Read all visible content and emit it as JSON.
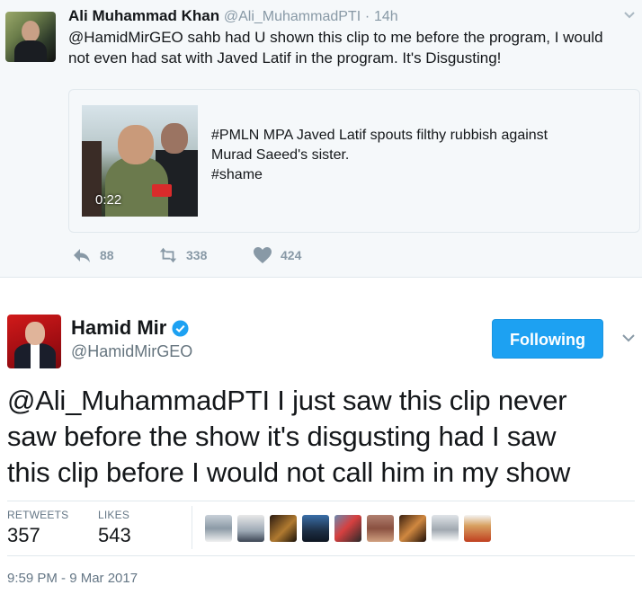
{
  "quoted_tweet": {
    "author_name": "Ali Muhammad Khan",
    "author_handle": "@Ali_MuhammadPTI",
    "separator": "·",
    "time_ago": "14h",
    "text": "@HamidMirGEO sahb had U shown this clip to me before the program, I would not even had sat with Javed Latif in the program. It's Disgusting!",
    "card": {
      "video_duration": "0:22",
      "lines": [
        "#PMLN MPA Javed Latif spouts filthy rubbish against",
        "Murad Saeed's sister.",
        "#shame"
      ]
    },
    "actions": {
      "replies": "88",
      "retweets": "338",
      "likes": "424"
    }
  },
  "main_tweet": {
    "author_name": "Hamid Mir",
    "author_handle": "@HamidMirGEO",
    "follow_label": "Following",
    "text_lines": [
      "@Ali_MuhammadPTI I just saw this clip never",
      "saw before the show it's disgusting had I saw",
      "this clip before I would not call him in my show"
    ],
    "stats": {
      "retweets_label": "RETWEETS",
      "retweets_value": "357",
      "likes_label": "LIKES",
      "likes_value": "543"
    },
    "timestamp": "9:59 PM - 9 Mar 2017"
  },
  "colors": {
    "accent": "#1da1f2",
    "muted": "#8899a6",
    "quoted_bg": "#f5f8fa",
    "verified": "#1da1f2"
  },
  "icons": [
    "chevron-down-icon",
    "reply-icon",
    "retweet-icon",
    "heart-icon",
    "verified-badge-icon"
  ]
}
